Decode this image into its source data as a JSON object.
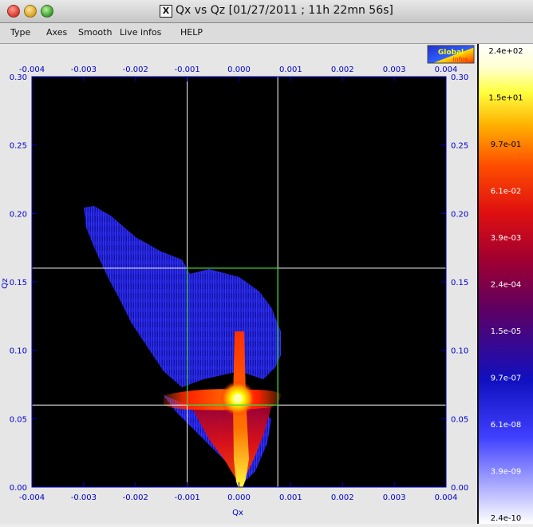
{
  "window": {
    "title": "Qx vs Qz [01/27/2011 ; 11h 22mn 56s]",
    "x11_glyph": "X"
  },
  "menu": [
    {
      "label": "Type",
      "name": "menu-type"
    },
    {
      "label": "Axes",
      "name": "menu-axes"
    },
    {
      "label": "Smooth",
      "name": "menu-smooth"
    },
    {
      "label": "Live infos",
      "name": "menu-live-infos"
    },
    {
      "label": "HELP",
      "name": "menu-help"
    }
  ],
  "logo": {
    "line1": "Global",
    "line2": "infos"
  },
  "chart_data": {
    "type": "heatmap",
    "xlabel": "Qx",
    "ylabel": "Qz",
    "xlim": [
      -0.004,
      0.004
    ],
    "ylim": [
      0.0,
      0.3
    ],
    "x_ticks": [
      "-0.004",
      "-0.003",
      "-0.002",
      "-0.001",
      "0.000",
      "0.001",
      "0.002",
      "0.003",
      "0.004"
    ],
    "y_ticks": [
      "0.00",
      "0.05",
      "0.10",
      "0.15",
      "0.20",
      "0.25",
      "0.30"
    ],
    "crosshair": {
      "x": [
        -0.001,
        0.00075
      ],
      "y": [
        0.06,
        0.16
      ]
    },
    "roi_box": {
      "x": [
        -0.001,
        0.00075
      ],
      "y": [
        0.06,
        0.16
      ]
    },
    "peak": {
      "qx": 0.0,
      "qz": 0.1
    },
    "colorbar_labels": [
      "2.4e+02",
      "1.5e+01",
      "9.7e-01",
      "6.1e-02",
      "3.9e-03",
      "2.4e-04",
      "1.5e-05",
      "9.7e-07",
      "6.1e-08",
      "3.9e-09",
      "2.4e-10"
    ],
    "colors": {
      "axis_text": "#0000cc",
      "crosshair": "#ffffff",
      "roi": "#33cc33",
      "background": "#000000"
    }
  }
}
